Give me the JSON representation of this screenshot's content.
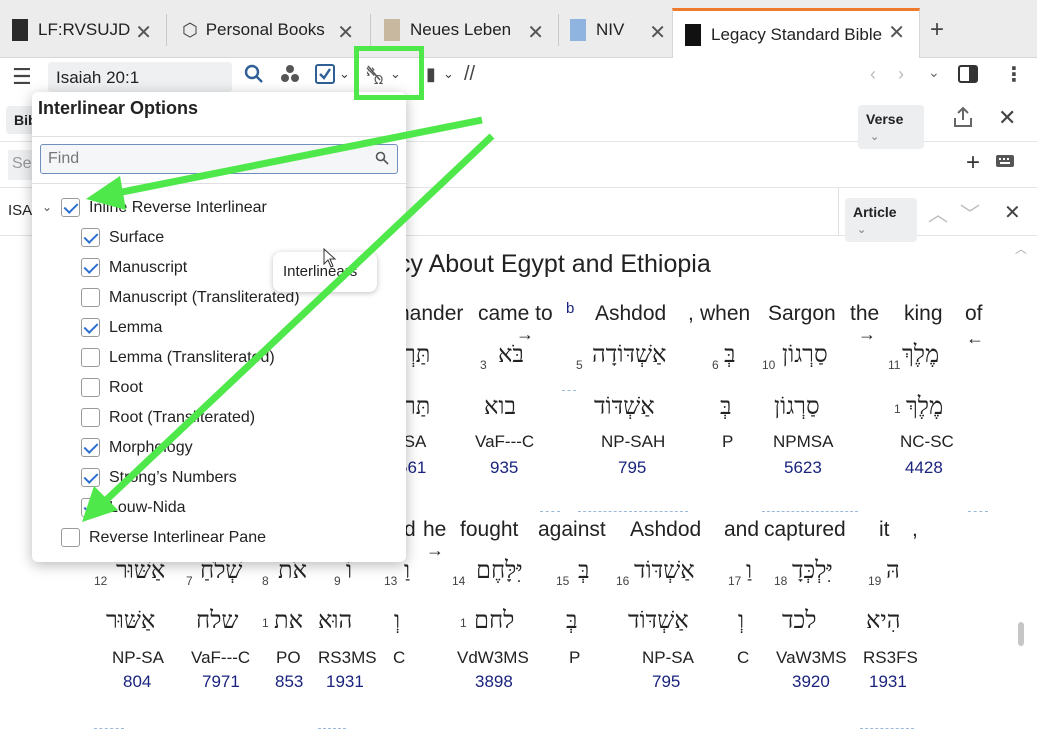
{
  "tabs": [
    {
      "label": "LF:RVSUJD"
    },
    {
      "label": "Personal Books"
    },
    {
      "label": "Neues Leben"
    },
    {
      "label": "NIV"
    },
    {
      "label": "Legacy Standard Bible"
    }
  ],
  "toolbar": {
    "reference": "Isaiah 20:1",
    "verse_label": "Verse"
  },
  "row2_partial": "Bib",
  "row3_partial": "Se",
  "row4_partial": "ISA",
  "article_label": "Article",
  "tooltip": "Interlinears",
  "panel": {
    "title": "Interlinear Options",
    "find_placeholder": "Find",
    "options": [
      {
        "label": "Inline Reverse Interlinear",
        "checked": true
      },
      {
        "label": "Surface",
        "checked": true
      },
      {
        "label": "Manuscript",
        "checked": true
      },
      {
        "label": "Manuscript (Transliterated)",
        "checked": false
      },
      {
        "label": "Lemma",
        "checked": true
      },
      {
        "label": "Lemma (Transliterated)",
        "checked": false
      },
      {
        "label": "Root",
        "checked": false
      },
      {
        "label": "Root (Transliterated)",
        "checked": false
      },
      {
        "label": "Morphology",
        "checked": true
      },
      {
        "label": "Strong’s Numbers",
        "checked": true
      },
      {
        "label": "Louw-Nida",
        "checked": true
      },
      {
        "label": "Reverse Interlinear Pane",
        "checked": false
      }
    ]
  },
  "content": {
    "heading": "cy About Egypt and Ethiopia",
    "line1": {
      "english": [
        "nander",
        "came to",
        "b",
        "Ashdod",
        ",",
        "when",
        "Sargon",
        "the",
        "king",
        "of"
      ],
      "hebrew": [
        "תַּרְ",
        "בֹּא",
        "אַשְׁדּוֹדָה",
        "בְּ",
        "סַרְגוֹן",
        "מֶלֶךְ"
      ],
      "nums": [
        "3",
        "5",
        "6",
        "10",
        "11"
      ],
      "lemma": [
        "תַּר",
        "בוא",
        "אַשְׁדּוֹד",
        "בְּ",
        "סַרְגוֹן",
        "מֶלֶךְ"
      ],
      "lemma_num": "1",
      "morph": [
        "-SA",
        "VaF---C",
        "NP-SAH",
        "P",
        "NPMSA",
        "NC-SC"
      ],
      "strongs": [
        "561",
        "935",
        "795",
        "5623",
        "4428"
      ]
    },
    "line2": {
      "english": [
        "d",
        "he",
        "fought",
        "against",
        "Ashdod",
        "and",
        "captured",
        "it",
        ","
      ],
      "hebrew": [
        "אַשּׁוּר",
        "שְׁלֹחַ",
        "אֹת",
        "וֹ",
        "וַ",
        "יִּלָּחֶם",
        "בְּ",
        "אַשְׁדּוֹד",
        "וַ",
        "יִּלְכְּדָ",
        "הּ"
      ],
      "nums": [
        "12",
        "7",
        "8",
        "9",
        "13",
        "14",
        "15",
        "16",
        "17",
        "18",
        "19"
      ],
      "lemma": [
        "אַשּׁוּר",
        "שלח",
        "את",
        "הוּא",
        "וְ",
        "לחם",
        "בְּ",
        "אַשְׁדּוֹד",
        "וְ",
        "לכד",
        "הִיא"
      ],
      "lemma_nums": [
        "1",
        "1"
      ],
      "morph": [
        "NP-SA",
        "VaF---C",
        "PO",
        "RS3MS",
        "C",
        "VdW3MS",
        "P",
        "NP-SA",
        "C",
        "VaW3MS",
        "RS3FS"
      ],
      "strongs": [
        "804",
        "7971",
        "853",
        "1931",
        "3898",
        "795",
        "3920",
        "1931"
      ]
    }
  },
  "colors": {
    "active_tab_accent": "#f07a2c",
    "check_blue": "#2d6fd1",
    "strong_blue": "#1a237e",
    "annotation_green": "#4ee84a"
  }
}
